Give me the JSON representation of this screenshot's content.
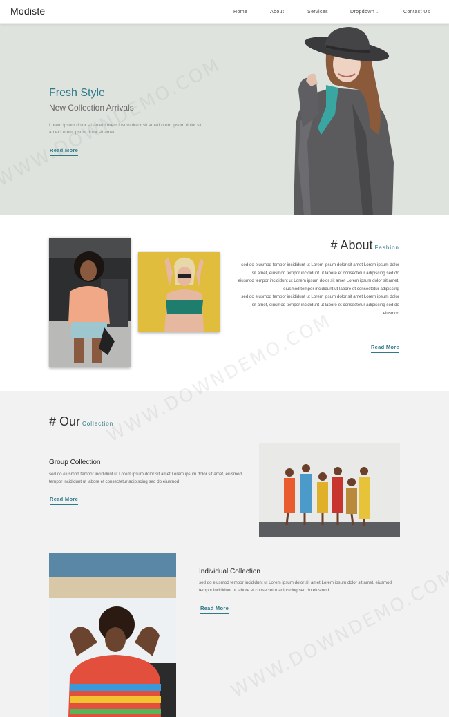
{
  "header": {
    "brand": "Modiste",
    "nav": [
      "Home",
      "About",
      "Services",
      "Dropdown",
      "Contact Us"
    ]
  },
  "hero": {
    "title": "Fresh Style",
    "subtitle": "New Collection Arrivals",
    "text": "Lorem ipsum dolor sit amet Lorem ipsum dolor sit ametLorem ipsum dolor sit amet Lorem ipsum dolor sit amet",
    "button": "Read More"
  },
  "about": {
    "title": "# About",
    "accent": "Fashion",
    "paragraph1": "sed do eiusmod tempor incididunt ut Lorem ipsum dolor sit amet Lorem ipsum dolor sit amet, eiusmod tempor incididunt ut labore et consectetur adipiscing sed do eiusmod tempor incididunt ut Lorem ipsum dolor sit amet Lorem ipsum dolor sit amet, eiusmod tempor incididunt ut labore et consectetur adipiscing",
    "paragraph2": "sed do eiusmod tempor incididunt ut Lorem ipsum dolor sit amet Lorem ipsum dolor sit amet, eiusmod tempor incididunt ut labore et consectetur adipiscing sed do eiusmod",
    "button": "Read More"
  },
  "collection": {
    "title": "# Our",
    "accent": "Collection",
    "group": {
      "heading": "Group Collection",
      "text": "sed do eiusmod tempor incididunt ut Lorem ipsum dolor sit amet Lorem ipsum dolor sit amet, eiusmod tempor incididunt ut labore et consectetur adipiscing sed do eiusmod",
      "button": "Read More"
    },
    "individual": {
      "heading": "Individual Collection",
      "text": "sed do eiusmod tempor incididunt ut Lorem ipsum dolor sit amet Lorem ipsum dolor sit amet, eiusmod tempor incididunt ut labore et consectetur adipiscing sed do eiusmod",
      "button": "Read More"
    }
  },
  "watermark": "WWW.DOWNDEMO.COM",
  "colors": {
    "accent": "#2e7a8a",
    "hero_bg": "#dfe3de",
    "collection_bg": "#f2f2f2"
  }
}
